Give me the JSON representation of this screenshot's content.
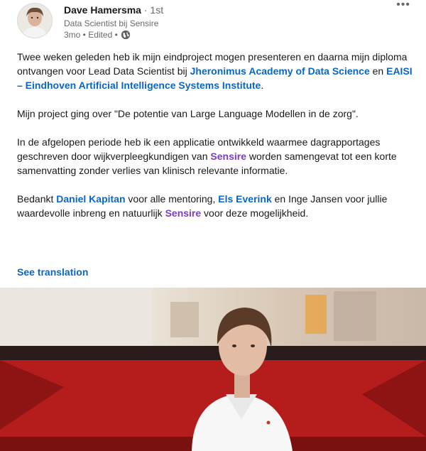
{
  "author": {
    "name": "Dave Hamersma",
    "degree": "· 1st",
    "headline": "Data Scientist bij Sensire",
    "time": "3mo • Edited •"
  },
  "menu_icon": "more-horizontal-icon",
  "visibility_icon": "globe-icon",
  "post": {
    "p1_a": "Twee weken geleden heb ik mijn eindproject mogen presenteren en daarna mijn diploma ontvangen voor Lead Data Scientist bij ",
    "p1_link1": "Jheronimus Academy of Data Science",
    "p1_b": " en ",
    "p1_link2": "EAISI – Eindhoven Artificial Intelligence Systems Institute",
    "p1_c": ".",
    "p2": "Mijn project ging over \"De potentie van Large Language Modellen in de zorg\".",
    "p3_a": "In de afgelopen periode heb ik een applicatie ontwikkeld waarmee dagrapportages geschreven door wijkverpleegkundigen van ",
    "p3_company": "Sensire",
    "p3_b": " worden samengevat tot een korte samenvatting zonder verlies van klinisch relevante informatie.",
    "p4_a": "Bedankt ",
    "p4_link1": "Daniel Kapitan",
    "p4_b": " voor alle mentoring, ",
    "p4_link2": "Els Everink",
    "p4_c": " en Inge Jansen voor jullie waardevolle inbreng en natuurlijk ",
    "p4_company": "Sensire",
    "p4_d": " voor deze mogelijkheid."
  },
  "see_translation": "See translation",
  "colors": {
    "link": "#0a66c2",
    "company_mention": "#7a3ec6",
    "stage_red": "#b51d1d"
  }
}
